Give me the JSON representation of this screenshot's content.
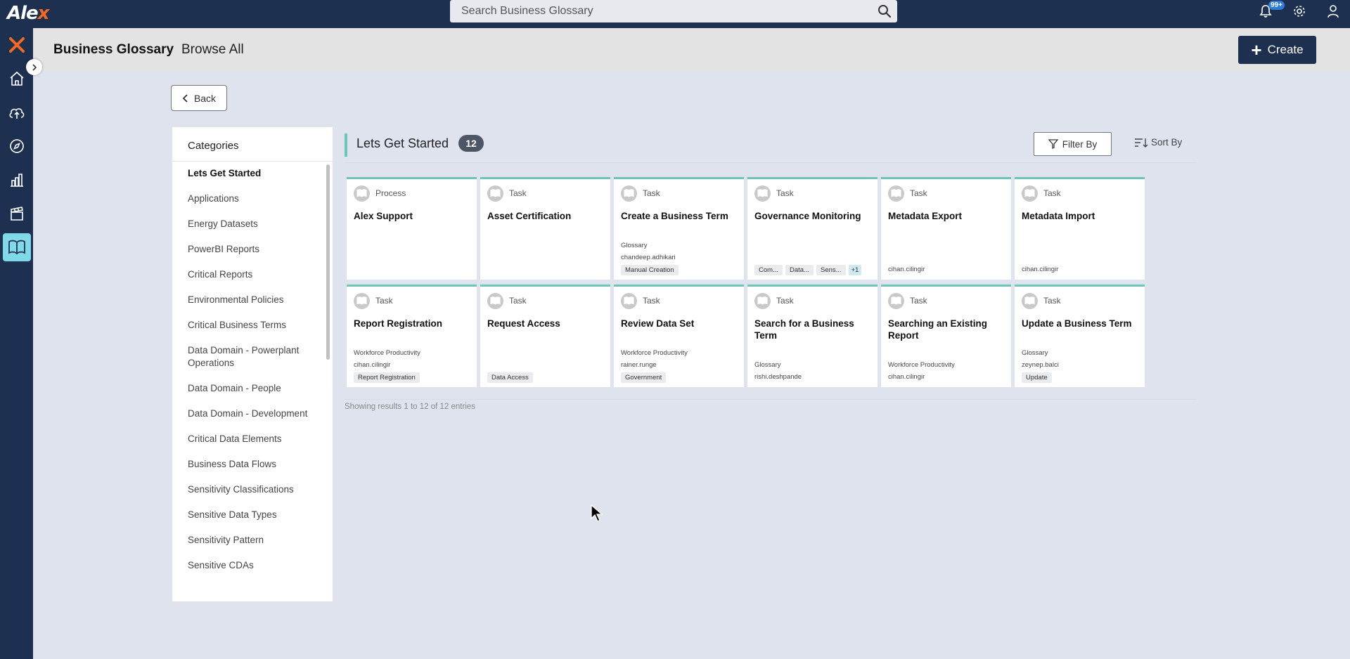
{
  "app": {
    "logo_text": "Ale",
    "logo_x": "x"
  },
  "search": {
    "placeholder": "Search Business Glossary"
  },
  "notifications": {
    "badge": "99+"
  },
  "header": {
    "title": "Business Glossary",
    "subtitle": "Browse All",
    "create_label": "Create"
  },
  "back_label": "Back",
  "categories": {
    "heading": "Categories",
    "items": [
      "Lets Get Started",
      "Applications",
      "Energy Datasets",
      "PowerBI Reports",
      "Critical Reports",
      "Environmental Policies",
      "Critical Business Terms",
      "Data Domain - Powerplant Operations",
      "Data Domain - People",
      "Data Domain - Development",
      "Critical Data Elements",
      "Business Data Flows",
      "Sensitivity Classifications",
      "Sensitive Data Types",
      "Sensitivity Pattern",
      "Sensitive CDAs"
    ]
  },
  "section": {
    "title": "Lets Get Started",
    "count": "12",
    "filter_label": "Filter By",
    "sort_label": "Sort By"
  },
  "cards": [
    {
      "type": "Process",
      "name": "Alex Support",
      "lines": [],
      "tags": []
    },
    {
      "type": "Task",
      "name": "Asset Certification",
      "lines": [],
      "tags": []
    },
    {
      "type": "Task",
      "name": "Create a Business Term",
      "lines": [
        "Glossary",
        "chandeep.adhikari"
      ],
      "tags": [
        "Manual Creation"
      ]
    },
    {
      "type": "Task",
      "name": "Governance Monitoring",
      "lines": [],
      "tags": [
        "Com...",
        "Data...",
        "Sens...",
        "+1"
      ]
    },
    {
      "type": "Task",
      "name": "Metadata Export",
      "lines": [
        "cihan.cilingir"
      ],
      "tags": []
    },
    {
      "type": "Task",
      "name": "Metadata Import",
      "lines": [
        "cihan.cilingir"
      ],
      "tags": []
    },
    {
      "type": "Task",
      "name": "Report Registration",
      "lines": [
        "Workforce Productivity",
        "cihan.cilingir"
      ],
      "tags": [
        "Report Registration"
      ]
    },
    {
      "type": "Task",
      "name": "Request Access",
      "lines": [],
      "tags": [
        "Data Access"
      ]
    },
    {
      "type": "Task",
      "name": "Review Data Set",
      "lines": [
        "Workforce Productivity",
        "rainer.runge"
      ],
      "tags": [
        "Government"
      ]
    },
    {
      "type": "Task",
      "name": "Search for a Business Term",
      "lines": [
        "Glossary",
        "rishi.deshpande"
      ],
      "tags": []
    },
    {
      "type": "Task",
      "name": "Searching an Existing Report",
      "lines": [
        "Workforce Productivity",
        "cihan.cilingir"
      ],
      "tags": []
    },
    {
      "type": "Task",
      "name": "Update a Business Term",
      "lines": [
        "Glossary",
        "zeynep.balci"
      ],
      "tags": [
        "Update"
      ]
    }
  ],
  "results_text": "Showing results 1 to 12 of 12 entries",
  "colors": {
    "navy": "#1e3050",
    "accent": "#6cc5b8",
    "active_nav": "#7fd9e8",
    "logo_orange": "#f26a22"
  }
}
